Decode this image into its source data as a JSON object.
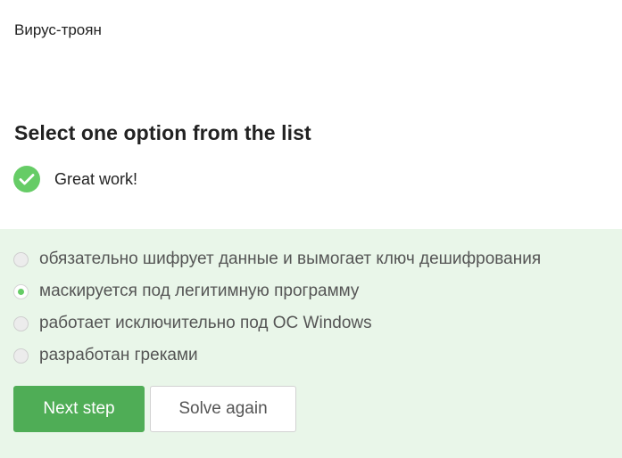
{
  "question": {
    "text": "Вирус-троян"
  },
  "instruction": {
    "title": "Select one option from the list"
  },
  "feedback": {
    "icon": "check-circle-icon",
    "text": "Great work!",
    "color": "#66cc66"
  },
  "options": [
    {
      "label": "обязательно шифрует данные и вымогает ключ дешифрования",
      "selected": false
    },
    {
      "label": "маскируется под легитимную программу",
      "selected": true
    },
    {
      "label": "работает исключительно под ОС Windows",
      "selected": false
    },
    {
      "label": "разработан греками",
      "selected": false
    }
  ],
  "buttons": {
    "next_label": "Next step",
    "again_label": "Solve again"
  },
  "colors": {
    "accent": "#4fad56",
    "panel_background": "#e9f6e9"
  }
}
